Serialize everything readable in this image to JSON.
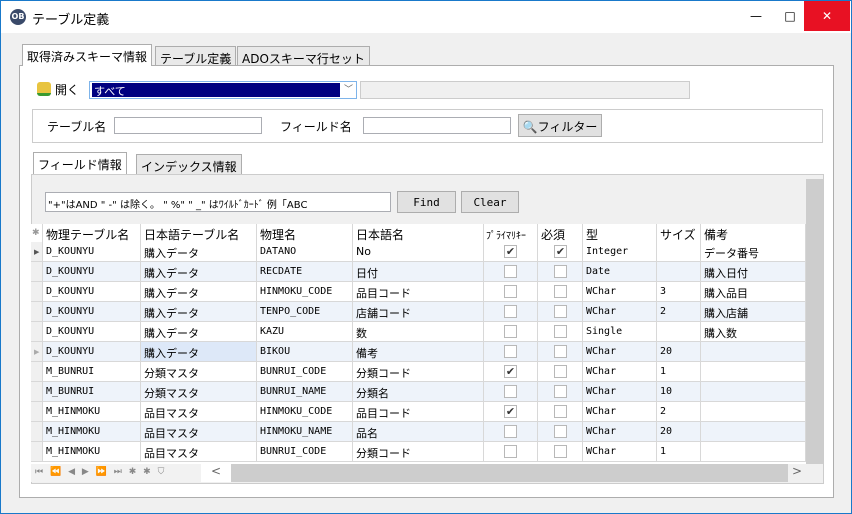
{
  "window": {
    "title": "テーブル定義",
    "app_icon": "ob-logo-icon",
    "minimize": "—",
    "maximize": "□",
    "close": "✕"
  },
  "tabs": [
    {
      "label": "取得済みスキーマ情報",
      "active": true
    },
    {
      "label": "テーブル定義"
    },
    {
      "label": "ADOスキーマ行セット"
    }
  ],
  "open": {
    "label": "開く",
    "icon": "open-database-icon",
    "selected": "すべて"
  },
  "filter": {
    "table_label": "テーブル名",
    "table_value": "",
    "field_label": "フィールド名",
    "field_value": "",
    "button": "フィルター"
  },
  "subtabs": [
    {
      "label": "フィールド情報",
      "active": true
    },
    {
      "label": "インデックス情報"
    }
  ],
  "search": {
    "value": "\"+\"はAND \" -\" は除く。 \" %\"   \" _\" はﾜｲﾙﾄﾞｶｰﾄﾞ  例「ABC",
    "find": "Find",
    "clear": "Clear"
  },
  "grid": {
    "columns": [
      "物理テーブル名",
      "日本語テーブル名",
      "物理名",
      "日本語名",
      "ﾌﾟﾗｲﾏﾘｷｰ",
      "必須",
      "型",
      "サイズ",
      "備考"
    ],
    "rows": [
      {
        "c": [
          "D_KOUNYU",
          "購入データ",
          "DATANO",
          "No",
          "",
          "",
          "Integer",
          "",
          "データ番号"
        ],
        "pk": true,
        "req": true
      },
      {
        "c": [
          "D_KOUNYU",
          "購入データ",
          "RECDATE",
          "日付",
          "",
          "",
          "Date",
          "",
          "購入日付"
        ],
        "pk": false,
        "req": false
      },
      {
        "c": [
          "D_KOUNYU",
          "購入データ",
          "HINMOKU_CODE",
          "品目コード",
          "",
          "",
          "WChar",
          "3",
          "購入品目"
        ],
        "pk": false,
        "req": false
      },
      {
        "c": [
          "D_KOUNYU",
          "購入データ",
          "TENPO_CODE",
          "店舗コード",
          "",
          "",
          "WChar",
          "2",
          "購入店舗"
        ],
        "pk": false,
        "req": false
      },
      {
        "c": [
          "D_KOUNYU",
          "購入データ",
          "KAZU",
          "数",
          "",
          "",
          "Single",
          "",
          "購入数"
        ],
        "pk": false,
        "req": false
      },
      {
        "c": [
          "D_KOUNYU",
          "購入データ",
          "BIKOU",
          "備考",
          "",
          "",
          "WChar",
          "20",
          ""
        ],
        "pk": false,
        "req": false
      },
      {
        "c": [
          "M_BUNRUI",
          "分類マスタ",
          "BUNRUI_CODE",
          "分類コード",
          "",
          "",
          "WChar",
          "1",
          ""
        ],
        "pk": true,
        "req": false
      },
      {
        "c": [
          "M_BUNRUI",
          "分類マスタ",
          "BUNRUI_NAME",
          "分類名",
          "",
          "",
          "WChar",
          "10",
          ""
        ],
        "pk": false,
        "req": false
      },
      {
        "c": [
          "M_HINMOKU",
          "品目マスタ",
          "HINMOKU_CODE",
          "品目コード",
          "",
          "",
          "WChar",
          "2",
          ""
        ],
        "pk": true,
        "req": false
      },
      {
        "c": [
          "M_HINMOKU",
          "品目マスタ",
          "HINMOKU_NAME",
          "品名",
          "",
          "",
          "WChar",
          "20",
          ""
        ],
        "pk": false,
        "req": false
      },
      {
        "c": [
          "M_HINMOKU",
          "品目マスタ",
          "BUNRUI_CODE",
          "分類コード",
          "",
          "",
          "WChar",
          "1",
          ""
        ],
        "pk": false,
        "req": false
      }
    ]
  },
  "navigator": [
    "⏮",
    "⏪",
    "◀",
    "▶",
    "⏩",
    "⏭",
    "✱",
    "✱",
    "⛉"
  ],
  "colors": {
    "selection": "#000080",
    "alt_row": "#eef3fa",
    "selected_cell": "#dde8f8",
    "close": "#e81123"
  }
}
